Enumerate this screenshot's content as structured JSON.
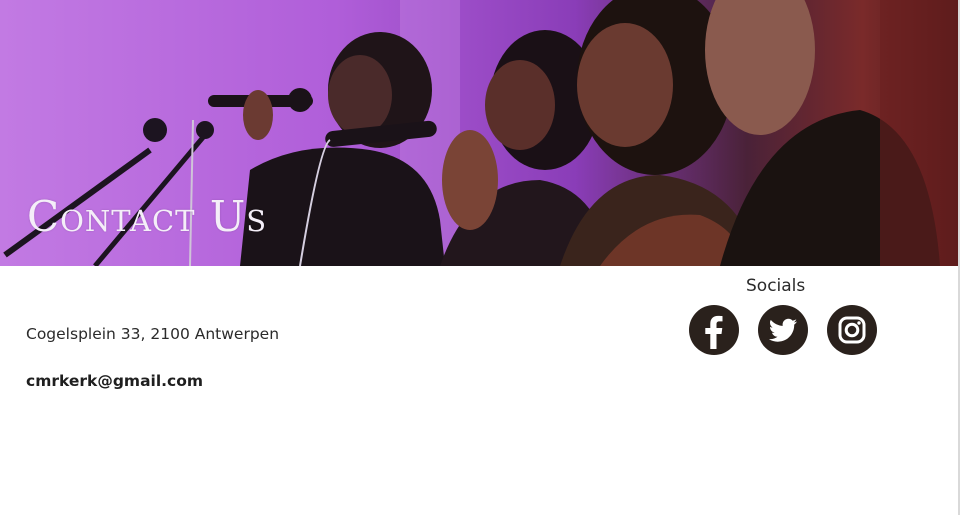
{
  "hero": {
    "title": "Contact Us"
  },
  "contact": {
    "address": "Cogelsplein 33, 2100 Antwerpen",
    "email": "cmrkerk@gmail.com"
  },
  "socials": {
    "heading": "Socials",
    "icons": [
      "facebook-icon",
      "twitter-icon",
      "instagram-icon"
    ],
    "icon_color": "#2a211c"
  },
  "colors": {
    "hero_purple": "#b16adb",
    "text": "#2b2b2b"
  }
}
